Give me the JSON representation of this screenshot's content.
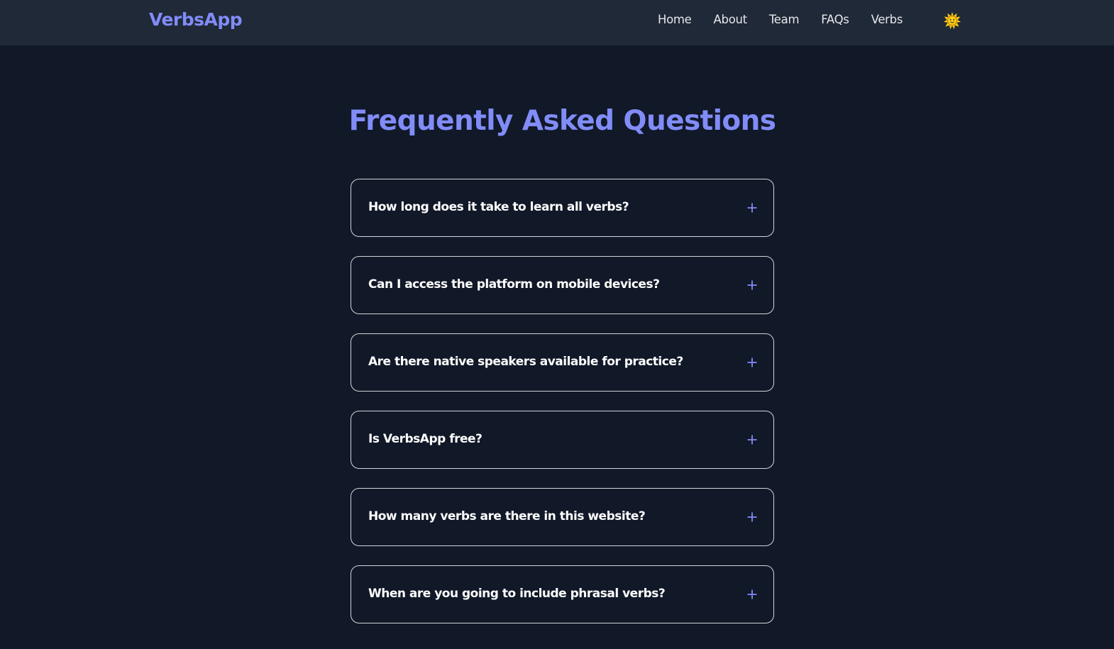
{
  "nav": {
    "brand": "VerbsApp",
    "links": [
      "Home",
      "About",
      "Team",
      "FAQs",
      "Verbs"
    ],
    "theme_icon": "sun-icon"
  },
  "faq": {
    "title": "Frequently Asked Questions",
    "expand_icon": "plus-icon",
    "items": [
      {
        "question": "How long does it take to learn all verbs?"
      },
      {
        "question": "Can I access the platform on mobile devices?"
      },
      {
        "question": "Are there native speakers available for practice?"
      },
      {
        "question": "Is VerbsApp free?"
      },
      {
        "question": "How many verbs are there in this website?"
      },
      {
        "question": "When are you going to include phrasal verbs?"
      }
    ]
  },
  "colors": {
    "background": "#111827",
    "navbar": "#1f2937",
    "accent": "#818cf8",
    "border": "#d1d5db",
    "sun": "#facc15"
  }
}
